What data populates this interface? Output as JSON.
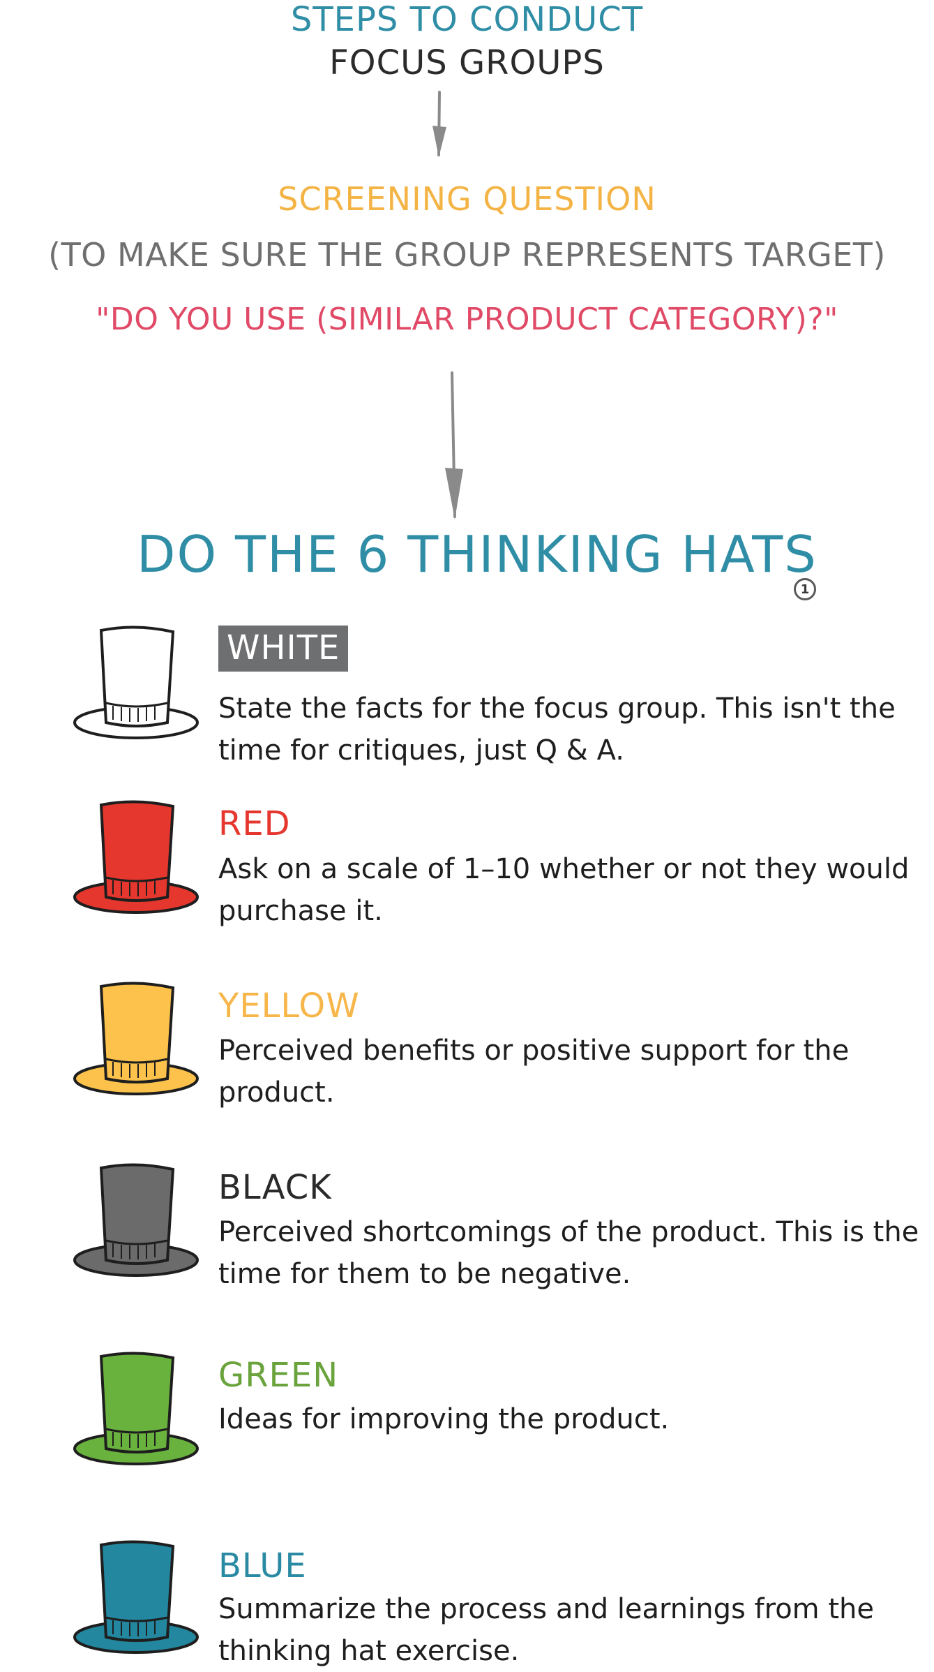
{
  "header": {
    "line1": "STEPS TO CONDUCT",
    "line2": "FOCUS GROUPS"
  },
  "screening": {
    "title": "SCREENING QUESTION",
    "subtitle": "(TO MAKE SURE THE GROUP REPRESENTS TARGET)",
    "question": "\"DO YOU USE (SIMILAR PRODUCT CATEGORY)?\""
  },
  "hats_section": {
    "title": "DO THE 6 THINKING HATS",
    "footnote": "1"
  },
  "hats": [
    {
      "label": "WHITE",
      "description": "State the facts for the focus group. This isn't the time for critiques, just Q & A.",
      "color": "#ffffff",
      "label_color": "#ffffff"
    },
    {
      "label": "RED",
      "description": "Ask on a scale of 1–10 whether or not they would purchase it.",
      "color": "#e5372e",
      "label_color": "#e5372e"
    },
    {
      "label": "YELLOW",
      "description": "Perceived benefits or positive support for the product.",
      "color": "#fcc24b",
      "label_color": "#f7b64a"
    },
    {
      "label": "BLACK",
      "description": "Perceived shortcomings of the product. This is the time for them to be negative.",
      "color": "#6b6b6b",
      "label_color": "#2a2a2a"
    },
    {
      "label": "GREEN",
      "description": "Ideas for improving the product.",
      "color": "#6ab23e",
      "label_color": "#6aa33c"
    },
    {
      "label": "BLUE",
      "description": "Summarize the process and learnings from the thinking hat exercise.",
      "color": "#23879f",
      "label_color": "#2b8aa3"
    }
  ]
}
